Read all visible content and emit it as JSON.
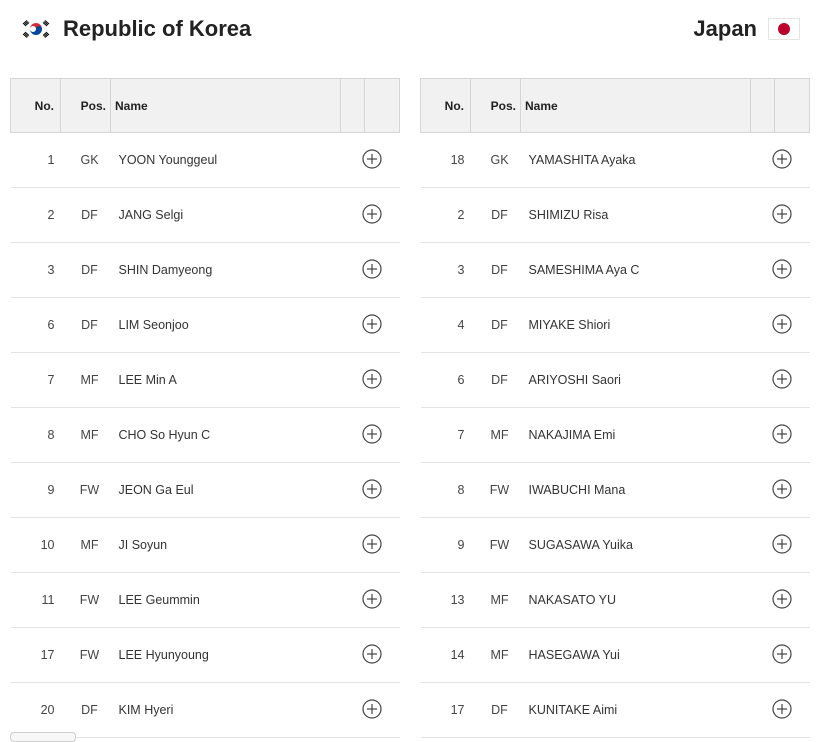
{
  "left_team": {
    "name": "Republic of Korea",
    "flag_icon": "south-korea-flag-icon",
    "players": [
      {
        "no": "1",
        "pos": "GK",
        "name": "YOON Younggeul"
      },
      {
        "no": "2",
        "pos": "DF",
        "name": "JANG Selgi"
      },
      {
        "no": "3",
        "pos": "DF",
        "name": "SHIN Damyeong"
      },
      {
        "no": "6",
        "pos": "DF",
        "name": "LIM Seonjoo"
      },
      {
        "no": "7",
        "pos": "MF",
        "name": "LEE Min A"
      },
      {
        "no": "8",
        "pos": "MF",
        "name": "CHO So Hyun C"
      },
      {
        "no": "9",
        "pos": "FW",
        "name": "JEON Ga Eul"
      },
      {
        "no": "10",
        "pos": "MF",
        "name": "JI Soyun"
      },
      {
        "no": "11",
        "pos": "FW",
        "name": "LEE Geummin"
      },
      {
        "no": "17",
        "pos": "FW",
        "name": "LEE Hyunyoung"
      },
      {
        "no": "20",
        "pos": "DF",
        "name": "KIM Hyeri"
      }
    ]
  },
  "right_team": {
    "name": "Japan",
    "flag_icon": "japan-flag-icon",
    "players": [
      {
        "no": "18",
        "pos": "GK",
        "name": "YAMASHITA Ayaka"
      },
      {
        "no": "2",
        "pos": "DF",
        "name": "SHIMIZU Risa"
      },
      {
        "no": "3",
        "pos": "DF",
        "name": "SAMESHIMA Aya C"
      },
      {
        "no": "4",
        "pos": "DF",
        "name": "MIYAKE Shiori"
      },
      {
        "no": "6",
        "pos": "DF",
        "name": "ARIYOSHI Saori"
      },
      {
        "no": "7",
        "pos": "MF",
        "name": "NAKAJIMA Emi"
      },
      {
        "no": "8",
        "pos": "FW",
        "name": "IWABUCHI Mana"
      },
      {
        "no": "9",
        "pos": "FW",
        "name": "SUGASAWA Yuika"
      },
      {
        "no": "13",
        "pos": "MF",
        "name": "NAKASATO YU"
      },
      {
        "no": "14",
        "pos": "MF",
        "name": "HASEGAWA Yui"
      },
      {
        "no": "17",
        "pos": "DF",
        "name": "KUNITAKE Aimi"
      }
    ]
  },
  "columns": {
    "no": "No.",
    "pos": "Pos.",
    "name": "Name"
  },
  "row_action_icon": "plus-circle-icon",
  "colors": {
    "header_bg": "#f1f1f1",
    "border": "#d5d5d5",
    "row_border": "#e3e3e3",
    "japan_red": "#bc002d",
    "korea_red": "#cd2e3a",
    "korea_blue": "#0047a0"
  }
}
